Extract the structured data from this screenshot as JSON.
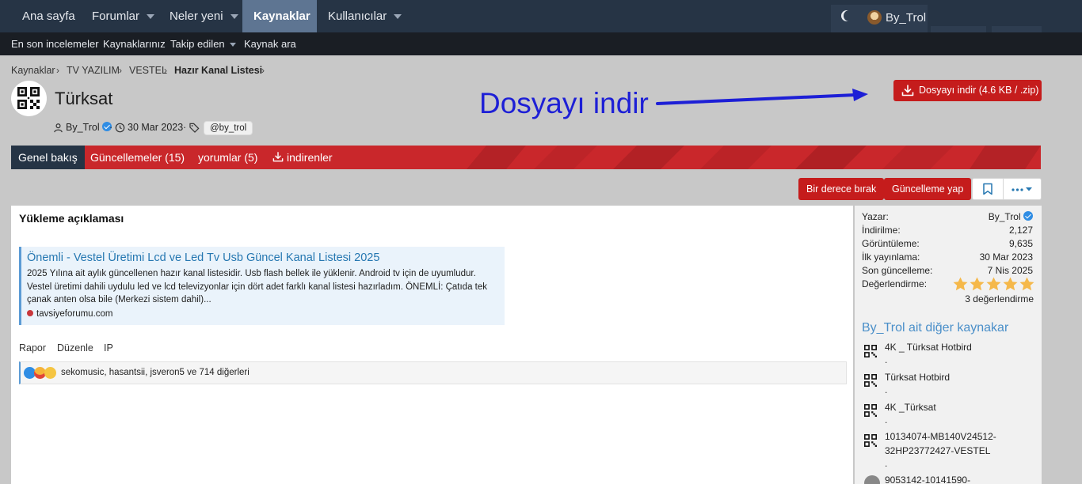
{
  "topnav": {
    "items": [
      {
        "label": "Ana sayfa",
        "caret": false,
        "active": false
      },
      {
        "label": "Forumlar",
        "caret": true,
        "active": false
      },
      {
        "label": "Neler yeni",
        "caret": true,
        "active": false
      },
      {
        "label": "Kaynaklar",
        "caret": false,
        "active": true
      },
      {
        "label": "Kullanıcılar",
        "caret": true,
        "active": false
      }
    ],
    "username": "By_Trol"
  },
  "subnav": {
    "items": [
      "En son incelemeler",
      "Kaynaklarınız",
      "Takip edilen",
      "Kaynak ara"
    ]
  },
  "breadcrumb": [
    "Kaynaklar",
    "TV YAZILIM",
    "VESTEL",
    "Hazır Kanal Listesi"
  ],
  "resource": {
    "title": "Türksat",
    "author": "By_Trol",
    "date": "30 Mar 2023",
    "tag": "@by_trol"
  },
  "annotation": "Dosyayı indir",
  "download_button": "Dosyayı indir (4.6 KB / .zip)",
  "tabs": [
    "Genel bakış",
    "Güncellemeler (15)",
    "yorumlar (5)",
    "indirenler"
  ],
  "actions": {
    "rate": "Bir derece bırak",
    "update": "Güncelleme yap"
  },
  "main": {
    "heading": "Yükleme açıklaması",
    "preview": {
      "title": "Önemli - Vestel Üretimi Lcd ve Led Tv Usb Güncel Kanal Listesi 2025",
      "body": "2025 Yılına ait aylık güncellenen hazır kanal listesidir. Usb flash bellek ile yüklenir. Android tv için de uyumludur. Vestel üretimi dahili uydulu led ve lcd televizyonlar için dört adet farklı kanal listesi hazırladım. ÖNEMLİ: Çatıda tek çanak anten olsa bile (Merkezi sistem dahil)...",
      "site": "tavsiyeforumu.com"
    },
    "links": [
      "Rapor",
      "Düzenle",
      "IP"
    ],
    "reactions": "sekomusic, hasantsii, jsveron5 ve 714 diğerleri"
  },
  "sidebar": {
    "info": [
      {
        "k": "Yazar:",
        "v": "By_Trol"
      },
      {
        "k": "İndirilme:",
        "v": "2,127"
      },
      {
        "k": "Görüntüleme:",
        "v": "9,635"
      },
      {
        "k": "İlk yayınlama:",
        "v": "30 Mar 2023"
      },
      {
        "k": "Son güncelleme:",
        "v": "7 Nis 2025"
      },
      {
        "k": "Değerlendirme:",
        "v": ""
      }
    ],
    "rating": {
      "value": 5,
      "max": 5,
      "count_text": "3 değerlendirme"
    },
    "other_heading": "By_Trol ait diğer kaynakar",
    "other_resources": [
      {
        "title": "4K _ Türksat Hotbird",
        "sub": "."
      },
      {
        "title": "Türksat Hotbird",
        "sub": "."
      },
      {
        "title": "4K _Türksat",
        "sub": "."
      },
      {
        "title": "10134074-MB140V24512-32HP23772427-VESTEL",
        "sub": "."
      },
      {
        "title": "9053142-10141590-",
        "sub": ""
      }
    ]
  },
  "colors": {
    "nav_bg": "#263445",
    "accent_red": "#c51c1c",
    "link_blue": "#2577b1",
    "annotation_blue": "#1d1fd6"
  }
}
